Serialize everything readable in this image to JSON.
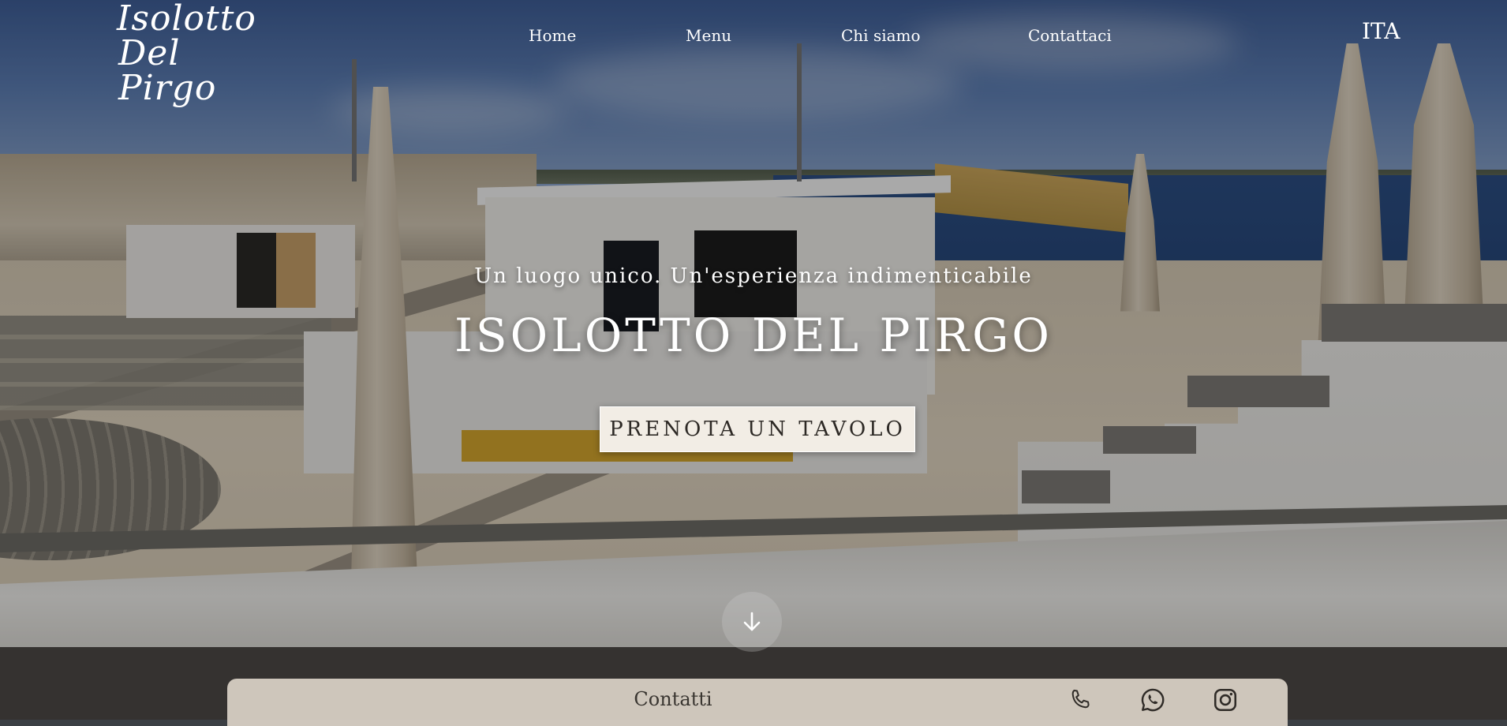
{
  "logo": {
    "line1": "Isolotto",
    "line2": "Del Pirgo"
  },
  "nav": {
    "items": [
      {
        "label": "Home"
      },
      {
        "label": "Menu"
      },
      {
        "label": "Chi siamo"
      },
      {
        "label": "Contattaci"
      }
    ],
    "language": "ITA"
  },
  "hero": {
    "tagline": "Un luogo unico. Un'esperienza indimenticabile",
    "title": "ISOLOTTO DEL PIRGO",
    "cta_label": "PRENOTA UN TAVOLO",
    "scroll_icon": "arrow-down-icon"
  },
  "contacts": {
    "label": "Contatti",
    "icons": [
      "phone-icon",
      "whatsapp-icon",
      "instagram-icon"
    ]
  },
  "colors": {
    "text_light": "#ffffff",
    "button_bg": "#f2ede5",
    "button_text": "#2d2925",
    "contact_bar_bg": "#dad2c6",
    "contact_text": "#3a3631"
  }
}
